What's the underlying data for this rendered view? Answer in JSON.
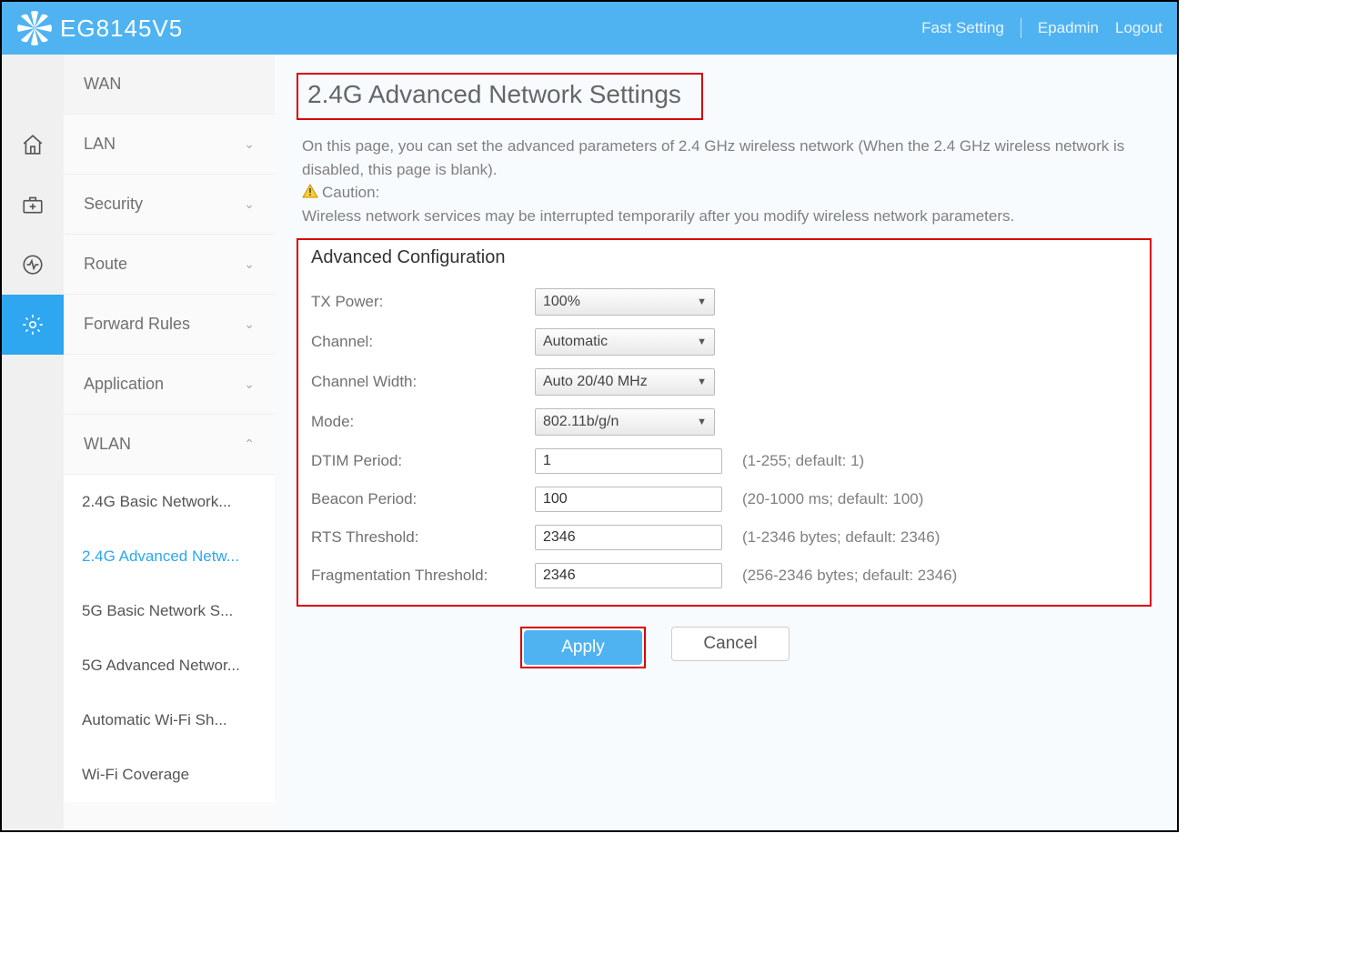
{
  "header": {
    "product": "EG8145V5",
    "links": {
      "fast": "Fast Setting",
      "user": "Epadmin",
      "logout": "Logout"
    }
  },
  "sidebar": {
    "sections": [
      {
        "label": "WAN",
        "expandable": false
      },
      {
        "label": "LAN",
        "expandable": true,
        "open": false
      },
      {
        "label": "Security",
        "expandable": true,
        "open": false
      },
      {
        "label": "Route",
        "expandable": true,
        "open": false
      },
      {
        "label": "Forward Rules",
        "expandable": true,
        "open": false
      },
      {
        "label": "Application",
        "expandable": true,
        "open": false
      },
      {
        "label": "WLAN",
        "expandable": true,
        "open": true
      }
    ],
    "wlan_sub": [
      {
        "label": "2.4G Basic Network...",
        "active": false
      },
      {
        "label": "2.4G Advanced Netw...",
        "active": true
      },
      {
        "label": "5G Basic Network S...",
        "active": false
      },
      {
        "label": "5G Advanced Networ...",
        "active": false
      },
      {
        "label": "Automatic Wi-Fi Sh...",
        "active": false
      },
      {
        "label": "Wi-Fi Coverage",
        "active": false
      }
    ]
  },
  "page": {
    "title": "2.4G Advanced Network Settings",
    "desc1": "On this page, you can set the advanced parameters of 2.4 GHz wireless network (When the 2.4 GHz wireless network is disabled, this page is blank).",
    "caution_label": "Caution:",
    "caution_text": "Wireless network services may be interrupted temporarily after you modify wireless network parameters."
  },
  "config": {
    "section_title": "Advanced Configuration",
    "tx_power": {
      "label": "TX Power:",
      "value": "100%"
    },
    "channel": {
      "label": "Channel:",
      "value": "Automatic"
    },
    "channel_width": {
      "label": "Channel Width:",
      "value": "Auto 20/40 MHz"
    },
    "mode": {
      "label": "Mode:",
      "value": "802.11b/g/n"
    },
    "dtim": {
      "label": "DTIM Period:",
      "value": "1",
      "hint": "(1-255; default: 1)"
    },
    "beacon": {
      "label": "Beacon Period:",
      "value": "100",
      "hint": "(20-1000 ms; default: 100)"
    },
    "rts": {
      "label": "RTS Threshold:",
      "value": "2346",
      "hint": "(1-2346 bytes; default: 2346)"
    },
    "frag": {
      "label": "Fragmentation Threshold:",
      "value": "2346",
      "hint": "(256-2346 bytes; default: 2346)"
    }
  },
  "buttons": {
    "apply": "Apply",
    "cancel": "Cancel"
  }
}
